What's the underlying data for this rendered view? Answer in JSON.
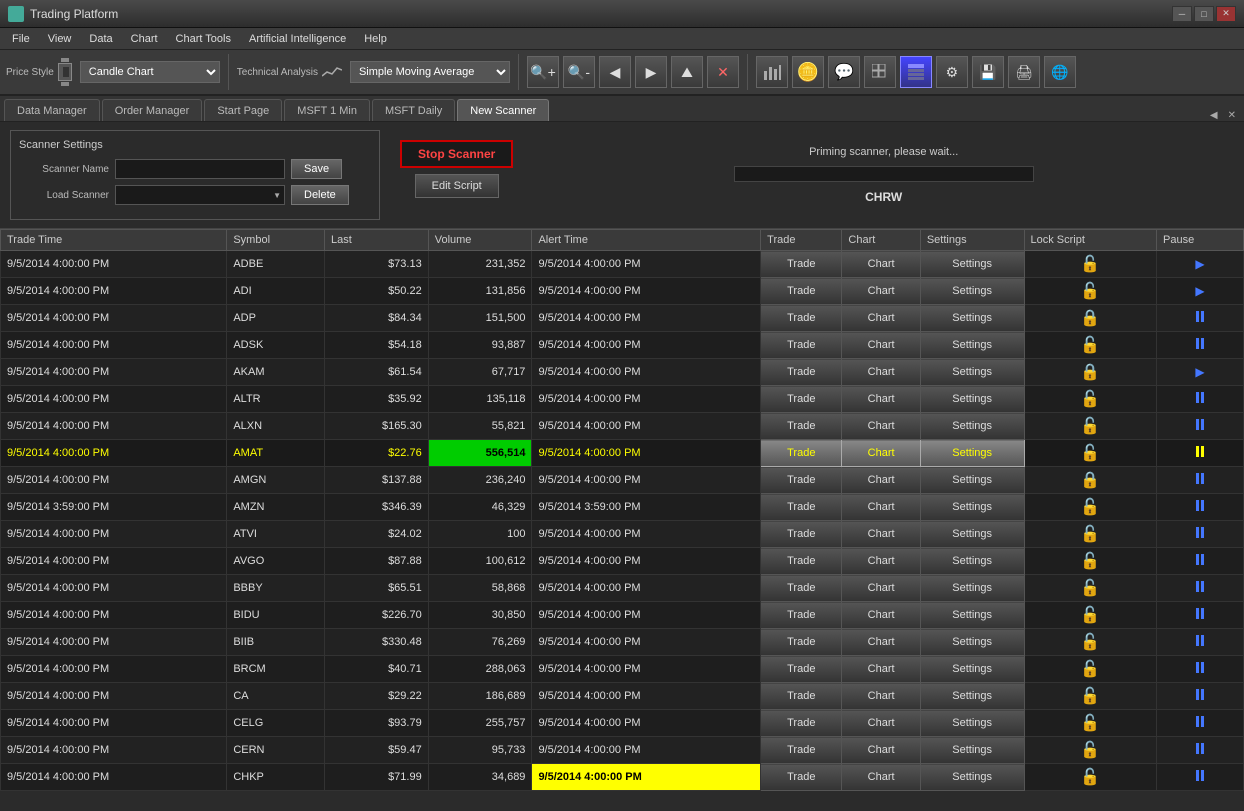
{
  "titleBar": {
    "icon": "📈",
    "title": "Trading Platform",
    "minBtn": "─",
    "maxBtn": "□",
    "closeBtn": "✕"
  },
  "menuBar": {
    "items": [
      "File",
      "View",
      "Data",
      "Chart",
      "Chart Tools",
      "Artificial Intelligence",
      "Help"
    ]
  },
  "toolbar": {
    "priceStyle": "Price Style",
    "candleChart": "Candle Chart",
    "technicalAnalysis": "Technical Analysis",
    "sma": "Simple Moving Average"
  },
  "tabs": {
    "items": [
      "Data Manager",
      "Order Manager",
      "Start Page",
      "MSFT 1 Min",
      "MSFT Daily",
      "New Scanner"
    ],
    "activeIndex": 5
  },
  "scanner": {
    "settingsTitle": "Scanner Settings",
    "scannerNameLabel": "Scanner Name",
    "loadScannerLabel": "Load Scanner",
    "saveBtn": "Save",
    "deleteBtn": "Delete",
    "stopScannerBtn": "Stop Scanner",
    "editScriptBtn": "Edit Script",
    "statusText": "Priming scanner, please wait...",
    "currentSymbol": "CHRW"
  },
  "tableHeaders": [
    "Trade Time",
    "Symbol",
    "Last",
    "Volume",
    "Alert Time",
    "Trade",
    "Chart",
    "Settings",
    "Lock Script",
    "Pause"
  ],
  "rows": [
    {
      "tradeTime": "9/5/2014 4:00:00 PM",
      "symbol": "ADBE",
      "last": "$73.13",
      "volume": "231,352",
      "alertTime": "9/5/2014 4:00:00 PM",
      "highlight": false,
      "lockOpen": true,
      "playBtn": true
    },
    {
      "tradeTime": "9/5/2014 4:00:00 PM",
      "symbol": "ADI",
      "last": "$50.22",
      "volume": "131,856",
      "alertTime": "9/5/2014 4:00:00 PM",
      "highlight": false,
      "lockOpen": true,
      "playBtn": true
    },
    {
      "tradeTime": "9/5/2014 4:00:00 PM",
      "symbol": "ADP",
      "last": "$84.34",
      "volume": "151,500",
      "alertTime": "9/5/2014 4:00:00 PM",
      "highlight": false,
      "lockOpen": false,
      "playBtn": false
    },
    {
      "tradeTime": "9/5/2014 4:00:00 PM",
      "symbol": "ADSK",
      "last": "$54.18",
      "volume": "93,887",
      "alertTime": "9/5/2014 4:00:00 PM",
      "highlight": false,
      "lockOpen": true,
      "playBtn": false
    },
    {
      "tradeTime": "9/5/2014 4:00:00 PM",
      "symbol": "AKAM",
      "last": "$61.54",
      "volume": "67,717",
      "alertTime": "9/5/2014 4:00:00 PM",
      "highlight": false,
      "lockOpen": false,
      "playBtn": true
    },
    {
      "tradeTime": "9/5/2014 4:00:00 PM",
      "symbol": "ALTR",
      "last": "$35.92",
      "volume": "135,118",
      "alertTime": "9/5/2014 4:00:00 PM",
      "highlight": false,
      "lockOpen": true,
      "playBtn": false
    },
    {
      "tradeTime": "9/5/2014 4:00:00 PM",
      "symbol": "ALXN",
      "last": "$165.30",
      "volume": "55,821",
      "alertTime": "9/5/2014 4:00:00 PM",
      "highlight": false,
      "lockOpen": true,
      "playBtn": false
    },
    {
      "tradeTime": "9/5/2014 4:00:00 PM",
      "symbol": "AMAT",
      "last": "$22.76",
      "volume": "556,514",
      "alertTime": "9/5/2014 4:00:00 PM",
      "highlight": true,
      "lockOpen": true,
      "playBtn": false
    },
    {
      "tradeTime": "9/5/2014 4:00:00 PM",
      "symbol": "AMGN",
      "last": "$137.88",
      "volume": "236,240",
      "alertTime": "9/5/2014 4:00:00 PM",
      "highlight": false,
      "lockOpen": false,
      "playBtn": false
    },
    {
      "tradeTime": "9/5/2014 3:59:00 PM",
      "symbol": "AMZN",
      "last": "$346.39",
      "volume": "46,329",
      "alertTime": "9/5/2014 3:59:00 PM",
      "highlight": false,
      "lockOpen": true,
      "playBtn": false
    },
    {
      "tradeTime": "9/5/2014 4:00:00 PM",
      "symbol": "ATVI",
      "last": "$24.02",
      "volume": "100",
      "alertTime": "9/5/2014 4:00:00 PM",
      "highlight": false,
      "lockOpen": true,
      "playBtn": false
    },
    {
      "tradeTime": "9/5/2014 4:00:00 PM",
      "symbol": "AVGO",
      "last": "$87.88",
      "volume": "100,612",
      "alertTime": "9/5/2014 4:00:00 PM",
      "highlight": false,
      "lockOpen": true,
      "playBtn": false
    },
    {
      "tradeTime": "9/5/2014 4:00:00 PM",
      "symbol": "BBBY",
      "last": "$65.51",
      "volume": "58,868",
      "alertTime": "9/5/2014 4:00:00 PM",
      "highlight": false,
      "lockOpen": true,
      "playBtn": false
    },
    {
      "tradeTime": "9/5/2014 4:00:00 PM",
      "symbol": "BIDU",
      "last": "$226.70",
      "volume": "30,850",
      "alertTime": "9/5/2014 4:00:00 PM",
      "highlight": false,
      "lockOpen": true,
      "playBtn": false
    },
    {
      "tradeTime": "9/5/2014 4:00:00 PM",
      "symbol": "BIIB",
      "last": "$330.48",
      "volume": "76,269",
      "alertTime": "9/5/2014 4:00:00 PM",
      "highlight": false,
      "lockOpen": true,
      "playBtn": false
    },
    {
      "tradeTime": "9/5/2014 4:00:00 PM",
      "symbol": "BRCM",
      "last": "$40.71",
      "volume": "288,063",
      "alertTime": "9/5/2014 4:00:00 PM",
      "highlight": false,
      "lockOpen": true,
      "playBtn": false
    },
    {
      "tradeTime": "9/5/2014 4:00:00 PM",
      "symbol": "CA",
      "last": "$29.22",
      "volume": "186,689",
      "alertTime": "9/5/2014 4:00:00 PM",
      "highlight": false,
      "lockOpen": true,
      "playBtn": false
    },
    {
      "tradeTime": "9/5/2014 4:00:00 PM",
      "symbol": "CELG",
      "last": "$93.79",
      "volume": "255,757",
      "alertTime": "9/5/2014 4:00:00 PM",
      "highlight": false,
      "lockOpen": true,
      "playBtn": false
    },
    {
      "tradeTime": "9/5/2014 4:00:00 PM",
      "symbol": "CERN",
      "last": "$59.47",
      "volume": "95,733",
      "alertTime": "9/5/2014 4:00:00 PM",
      "highlight": false,
      "lockOpen": true,
      "playBtn": false
    },
    {
      "tradeTime": "9/5/2014 4:00:00 PM",
      "symbol": "CHKP",
      "last": "$71.99",
      "volume": "34,689",
      "alertTime": "9/5/2014 4:00:00 PM",
      "highlightAlert": true,
      "highlight": false,
      "lockOpen": true,
      "playBtn": false
    }
  ]
}
